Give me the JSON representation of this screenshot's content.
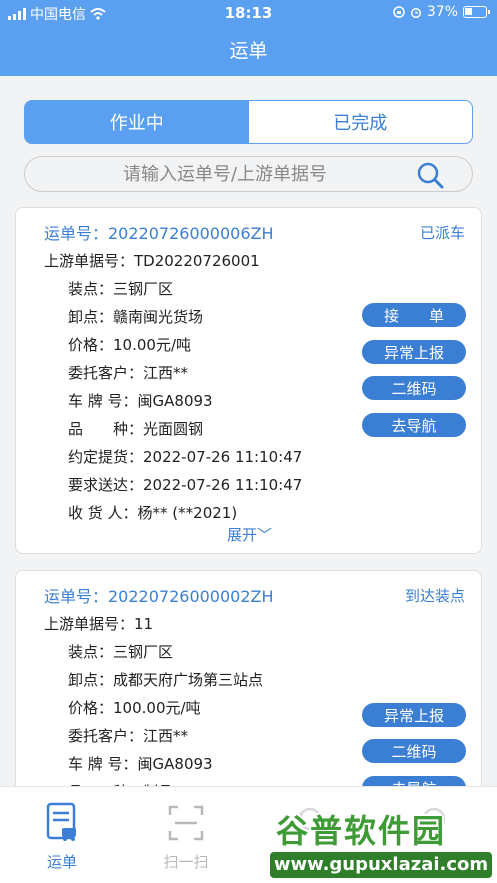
{
  "status_bar": {
    "carrier": "中国电信",
    "time": "18:13",
    "battery": "37%",
    "battery_level": 0.37
  },
  "header": {
    "title": "运单"
  },
  "tabs": [
    {
      "label": "作业中",
      "active": true
    },
    {
      "label": "已完成",
      "active": false
    }
  ],
  "search": {
    "placeholder": "请输入运单号/上游单据号",
    "value": ""
  },
  "cards": [
    {
      "waybill": "运单号：20220726000006ZH",
      "status": "已派车",
      "fields": [
        "上游单据号：TD20220726001",
        "装点：三钢厂区",
        "卸点：赣南闽光货场",
        "价格：10.00元/吨",
        "委托客户：江西**",
        "车 牌 号：闽GA8093",
        "品　　种：光面圆钢",
        "约定提货：2022-07-26 11:10:47",
        "要求送达：2022-07-26 11:10:47",
        "收 货 人：杨** (**2021)"
      ],
      "actions": [
        "接　　单",
        "异常上报",
        "二维码",
        "去导航"
      ],
      "expand_label": "展开﹀"
    },
    {
      "waybill": "运单号：20220726000002ZH",
      "status": "到达装点",
      "fields": [
        "上游单据号：11",
        "装点：三钢厂区",
        "卸点：成都天府广场第三站点",
        "价格：100.00元/吨",
        "委托客户：江西**",
        "车 牌 号：闽GA8093",
        "品　　种：制品"
      ],
      "actions": [
        "异常上报",
        "二维码",
        "去导航"
      ]
    }
  ],
  "bottom_nav": [
    {
      "label": "运单",
      "icon": "waybill-icon",
      "active": true
    },
    {
      "label": "扫一扫",
      "icon": "scan-icon",
      "active": false
    }
  ],
  "watermark": {
    "title": "谷普软件园",
    "url": "www.gupuxlazai.com"
  },
  "colors": {
    "primary": "#5b9ff0",
    "accent": "#3b7fd4",
    "background": "#f2f3f5"
  }
}
